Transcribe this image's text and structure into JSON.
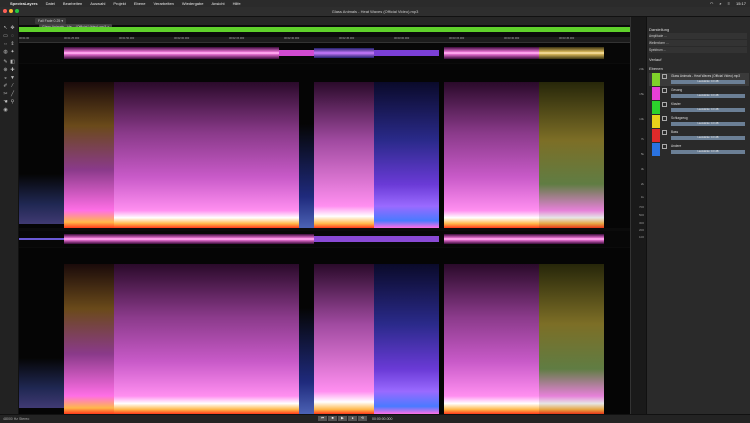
{
  "menubar": {
    "app": "SpectraLayers",
    "items": [
      "Datei",
      "Bearbeiten",
      "Auswahl",
      "Projekt",
      "Ebene",
      "Verarbeiten",
      "Wiedergabe",
      "Ansicht",
      "Hilfe"
    ],
    "time": "15:17"
  },
  "window": {
    "title": "Glass Animals - Heat Waves (Official Video).mp3"
  },
  "tabs": [
    "Fall Fade 0.25 ▾",
    "Glass Animals - He... (Official Video).mp3 ×"
  ],
  "ruler": {
    "labels": [
      "00:01:00",
      "00:01:25.000",
      "00:01:50.000",
      "00:02:00.000",
      "00:02:15.000",
      "00:02:30.000",
      "00:02:45.000",
      "00:03:00.000",
      "00:03:15.000",
      "00:03:30.000",
      "00:03:45.000"
    ]
  },
  "freq_scale": {
    "labels": [
      "20k",
      "15k",
      "10k",
      "7k",
      "5k",
      "3k",
      "2k",
      "1k",
      "700",
      "500",
      "300",
      "200",
      "100"
    ]
  },
  "panel": {
    "sections": {
      "darstellung": "Darstellung",
      "verlauf": "Verlauf",
      "ebenen": "Ebenen"
    },
    "rows": [
      "Amplitude ...",
      "Wellenform ...",
      "Spektrum ..."
    ],
    "layers": [
      {
        "name": "Glass Animals - Heat Waves (Official Video).mp3",
        "bar": "Lautstärke: 0.0 dB",
        "color": "#7fd12a"
      },
      {
        "name": "Gesang",
        "bar": "Lautstärke: 0.0 dB",
        "color": "#e63fd6"
      },
      {
        "name": "Klavier",
        "bar": "Lautstärke: 0.0 dB",
        "color": "#2cd12c"
      },
      {
        "name": "Schlagzeug",
        "bar": "Lautstärke: 0.0 dB",
        "color": "#e8d21a"
      },
      {
        "name": "Bass",
        "bar": "Lautstärke: 0.0 dB",
        "color": "#e02a2a"
      },
      {
        "name": "Andere",
        "bar": "Lautstärke: 0.0 dB",
        "color": "#2a72e0"
      }
    ]
  },
  "status": {
    "left": "48000 Hz Stereo",
    "timecode": "00:00:00.000"
  }
}
